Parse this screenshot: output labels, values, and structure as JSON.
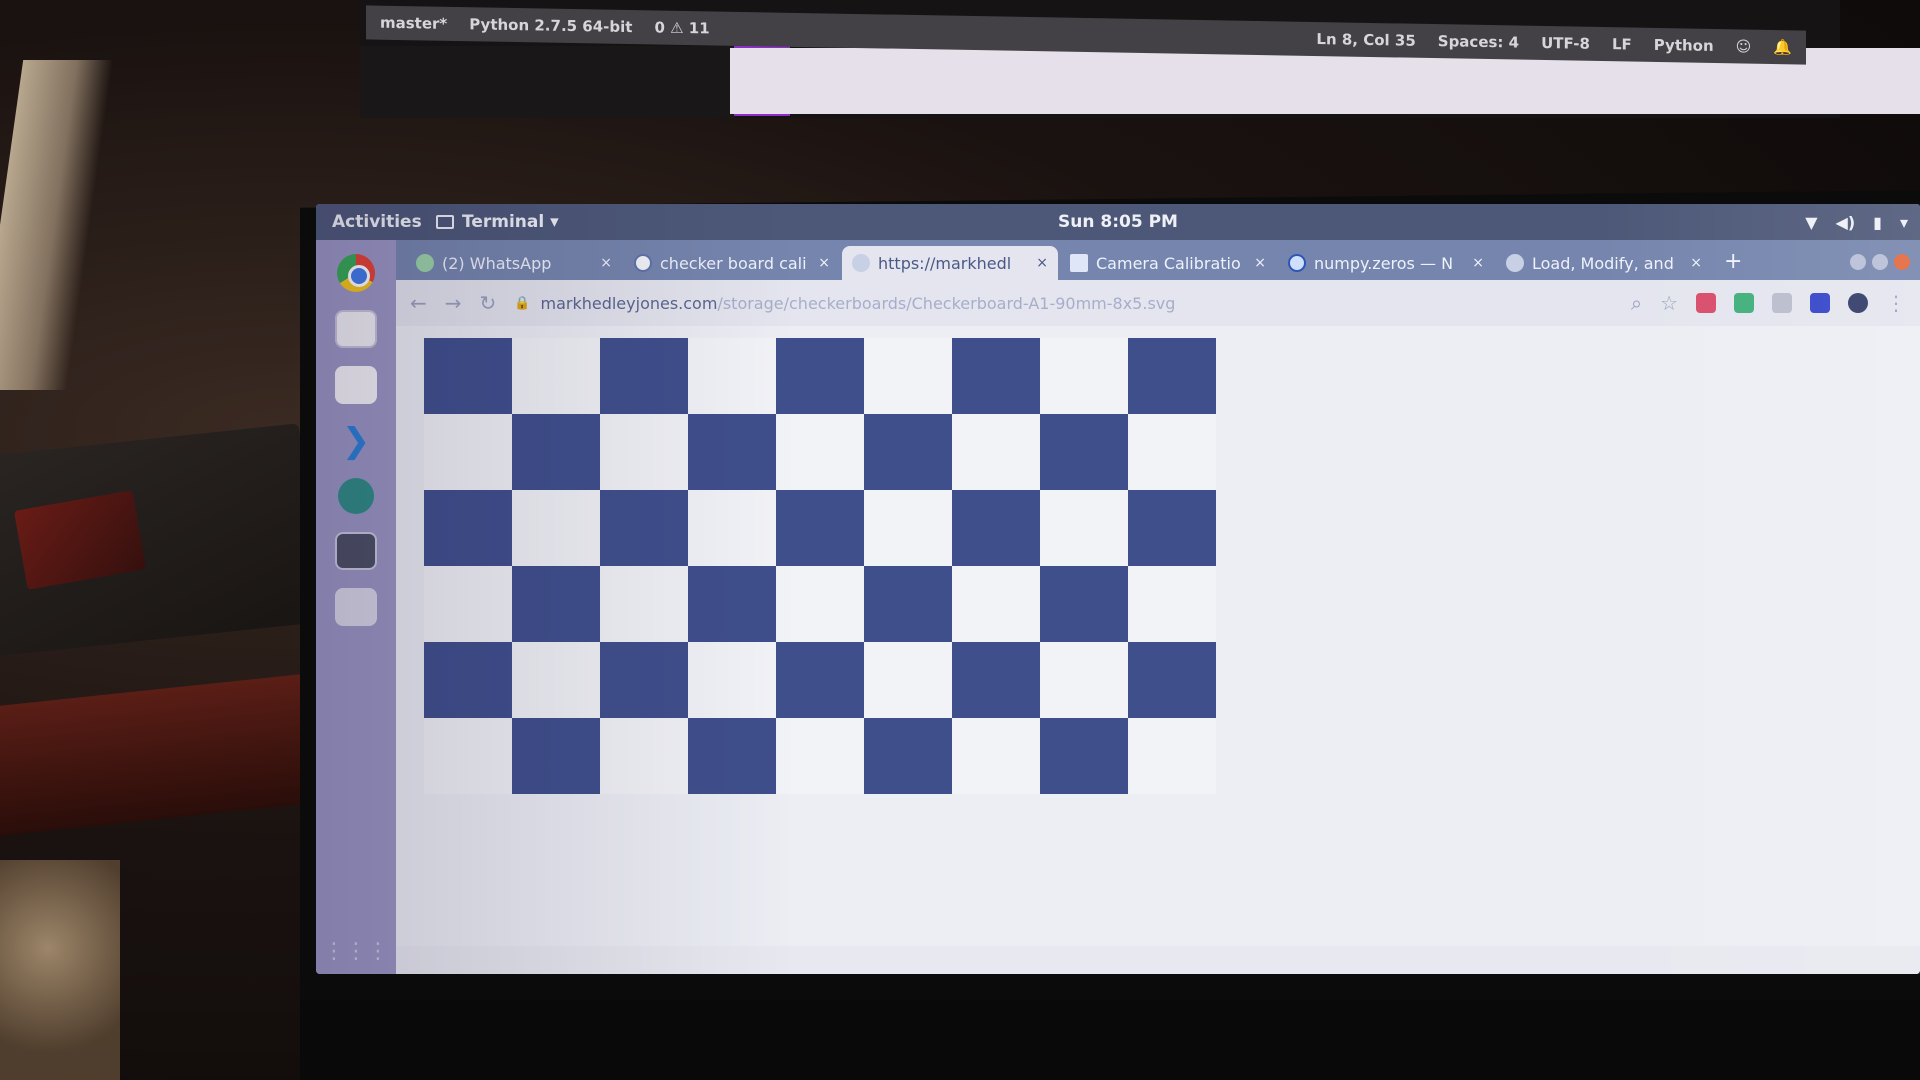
{
  "top_monitor": {
    "status_left": [
      "master*",
      "Python 2.7.5 64-bit",
      "0 ⚠ 11"
    ],
    "status_right": [
      "Ln 8, Col 35",
      "Spaces: 4",
      "UTF-8",
      "LF",
      "Python"
    ]
  },
  "gnome": {
    "activities": "Activities",
    "app_name": "Terminal ▾",
    "clock": "Sun  8:05 PM"
  },
  "tabs": [
    {
      "label": "(2) WhatsApp",
      "icon": "whatsapp-icon"
    },
    {
      "label": "checker board cali",
      "icon": "google-icon"
    },
    {
      "label": "https://markhedl",
      "icon": "globe-icon",
      "active": true
    },
    {
      "label": "Camera Calibratio",
      "icon": "doc-icon"
    },
    {
      "label": "numpy.zeros — N",
      "icon": "numpy-icon"
    },
    {
      "label": "Load, Modify, and",
      "icon": "page-icon"
    }
  ],
  "tab_close": "×",
  "new_tab": "+",
  "address": {
    "host": "markhedleyjones.com",
    "path": "/storage/checkerboards/Checkerboard-A1-90mm-8x5.svg"
  },
  "checkerboard": {
    "rows": 6,
    "cols": 9,
    "dark_color": "#3f4f8c",
    "light_color": "#f2f3f7"
  }
}
